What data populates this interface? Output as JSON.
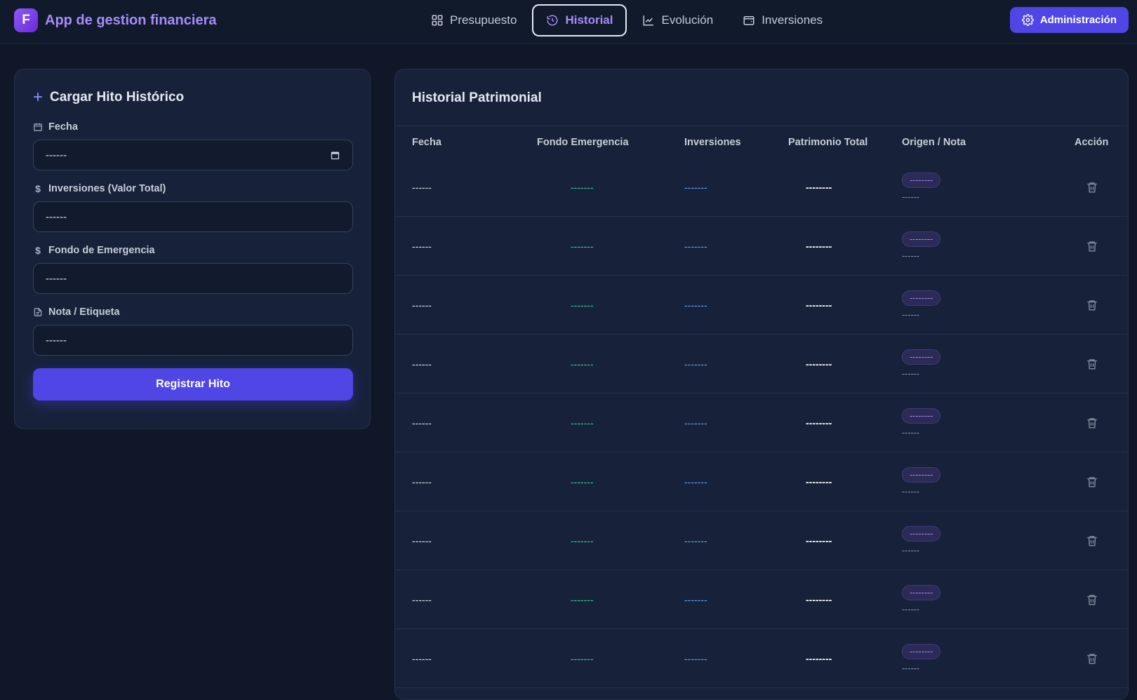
{
  "app": {
    "logo_letter": "F",
    "name": "App de gestion financiera"
  },
  "nav": {
    "tabs": [
      {
        "label": "Presupuesto",
        "icon": "grid-icon"
      },
      {
        "label": "Historial",
        "icon": "history-icon",
        "active": true
      },
      {
        "label": "Evolución",
        "icon": "line-chart-icon"
      },
      {
        "label": "Inversiones",
        "icon": "wallet-icon"
      }
    ],
    "admin_label": "Administración"
  },
  "form": {
    "title": "Cargar Hito Histórico",
    "fecha": {
      "label": "Fecha",
      "value": "------"
    },
    "inversiones": {
      "label": "Inversiones (Valor Total)",
      "placeholder": "------"
    },
    "fondo": {
      "label": "Fondo de Emergencia",
      "placeholder": "------"
    },
    "nota": {
      "label": "Nota / Etiqueta",
      "placeholder": "------"
    },
    "submit_label": "Registrar Hito"
  },
  "table": {
    "title": "Historial Patrimonial",
    "headers": {
      "fecha": "Fecha",
      "fondo": "Fondo Emergencia",
      "inversiones": "Inversiones",
      "patrimonio": "Patrimonio Total",
      "origen": "Origen / Nota",
      "accion": "Acción"
    },
    "rows": [
      {
        "fecha": "------",
        "fondo": "-------",
        "inversiones": "-------",
        "patrimonio": "--------",
        "origen": "--------",
        "nota": "------"
      },
      {
        "fecha": "------",
        "fondo": "-------",
        "inversiones": "-------",
        "patrimonio": "--------",
        "origen": "--------",
        "nota": "------"
      },
      {
        "fecha": "------",
        "fondo": "-------",
        "inversiones": "-------",
        "patrimonio": "--------",
        "origen": "--------",
        "nota": "------"
      },
      {
        "fecha": "------",
        "fondo": "-------",
        "inversiones": "-------",
        "patrimonio": "--------",
        "origen": "--------",
        "nota": "------"
      },
      {
        "fecha": "------",
        "fondo": "-------",
        "inversiones": "-------",
        "patrimonio": "--------",
        "origen": "--------",
        "nota": "------"
      },
      {
        "fecha": "------",
        "fondo": "-------",
        "inversiones": "-------",
        "patrimonio": "--------",
        "origen": "--------",
        "nota": "------"
      },
      {
        "fecha": "------",
        "fondo": "-------",
        "inversiones": "-------",
        "patrimonio": "--------",
        "origen": "--------",
        "nota": "------"
      },
      {
        "fecha": "------",
        "fondo": "-------",
        "inversiones": "-------",
        "patrimonio": "--------",
        "origen": "--------",
        "nota": "------"
      },
      {
        "fecha": "------",
        "fondo": "-------",
        "inversiones": "-------",
        "patrimonio": "--------",
        "origen": "--------",
        "nota": "------"
      }
    ]
  },
  "colors": {
    "accent": "#4f46e5",
    "brand_text": "#a78bfa",
    "fondo_value": "#34d399",
    "inversiones_value": "#60a5fa",
    "background": "#0f1728",
    "card": "#17223a"
  }
}
